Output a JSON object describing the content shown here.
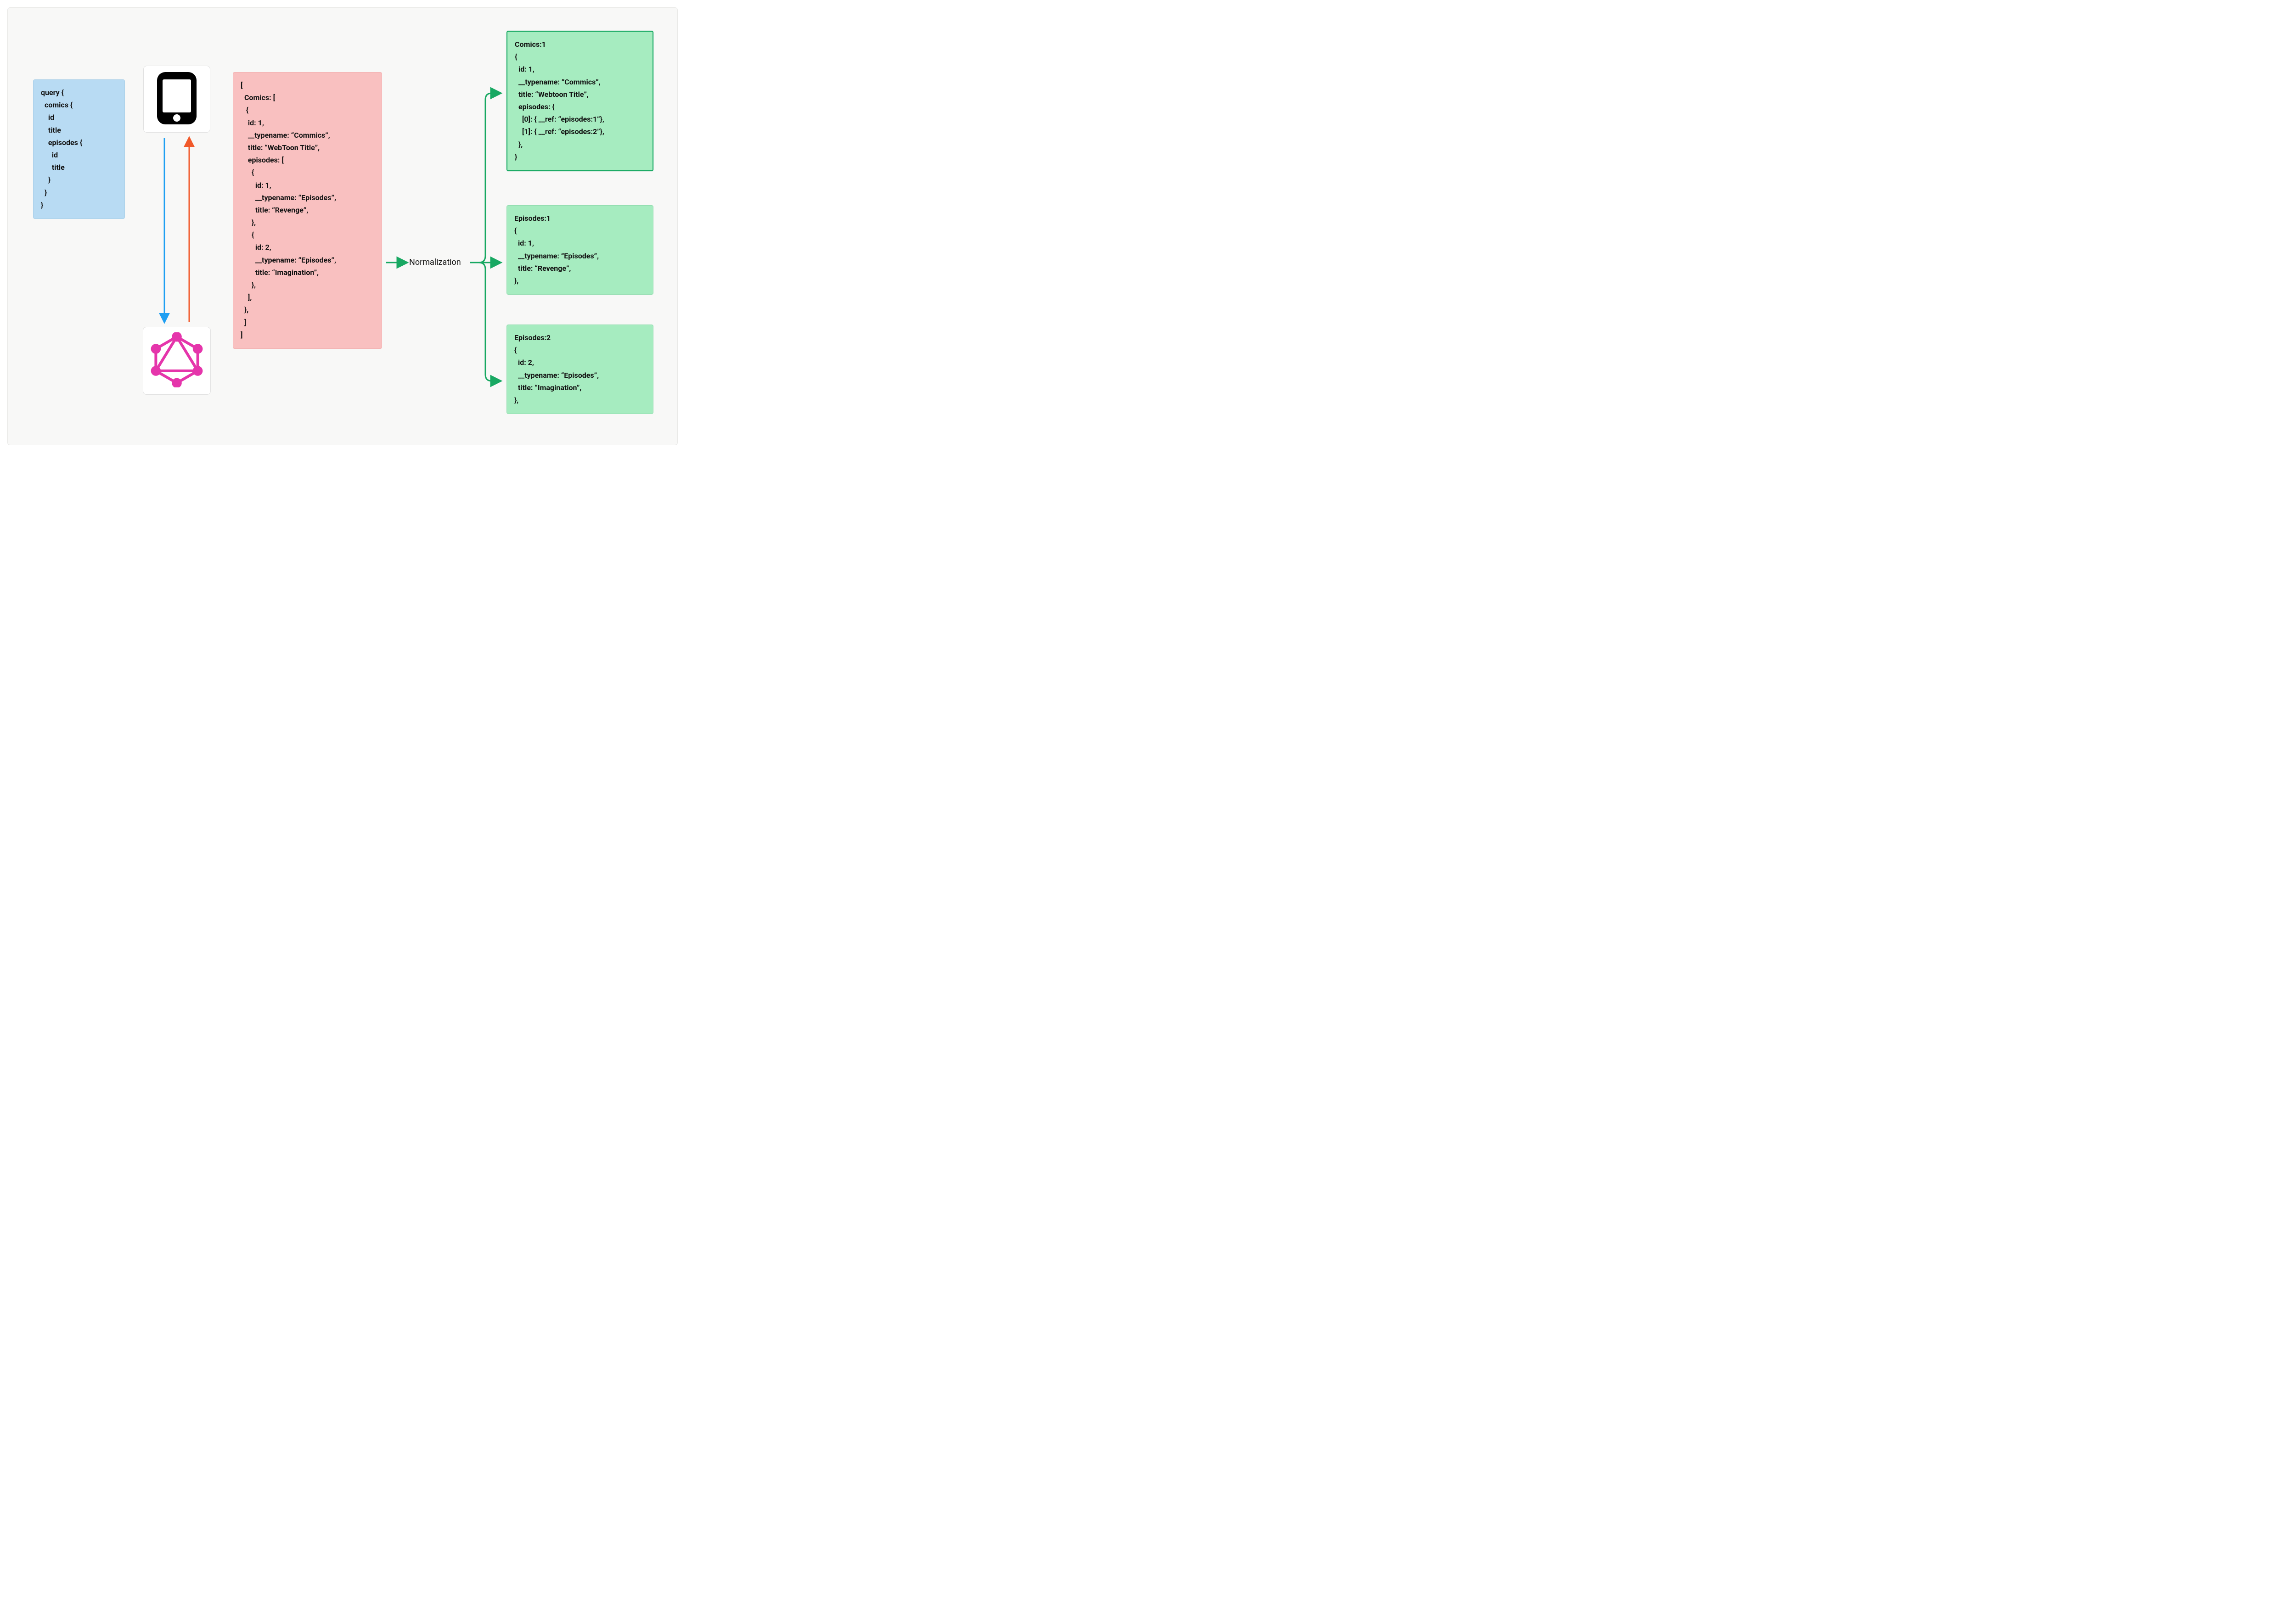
{
  "query_box": "query {\n  comics {\n    id\n    title\n    episodes {\n      id\n      title\n    }\n  }\n}",
  "response_box": "[\n  Comics: [\n   {\n    id: 1,\n    __typename: “Commics”,\n    title: “WebToon Title”,\n    episodes: [\n      {\n        id: 1,\n        __typename: “Episodes”,\n        title: “Revenge”,\n      },\n      {\n        id: 2,\n        __typename: “Episodes”,\n        title: “Imagination”,\n      },\n    ],\n  },\n  ]\n]",
  "cache": {
    "comics1": "Comics:1\n{\n  id: 1,\n  __typename: “Commics”,\n  title: “Webtoon Title”,\n  episodes: {\n    [0]: { __ref: “episodes:1”},\n    [1]: { __ref: “episodes:2”},\n  },\n}",
    "episodes1": "Episodes:1\n{\n  id: 1,\n  __typename: “Episodes”,\n  title: “Revenge”,\n},",
    "episodes2": "Episodes:2\n{\n  id: 2,\n  __typename: “Episodes”,\n  title: “Imagination”,\n},"
  },
  "label_normalization": "Normalization",
  "colors": {
    "arrow_green": "#18a862",
    "arrow_blue": "#1f9ff2",
    "arrow_red": "#f1592a",
    "graphql_pink": "#e535ab"
  }
}
